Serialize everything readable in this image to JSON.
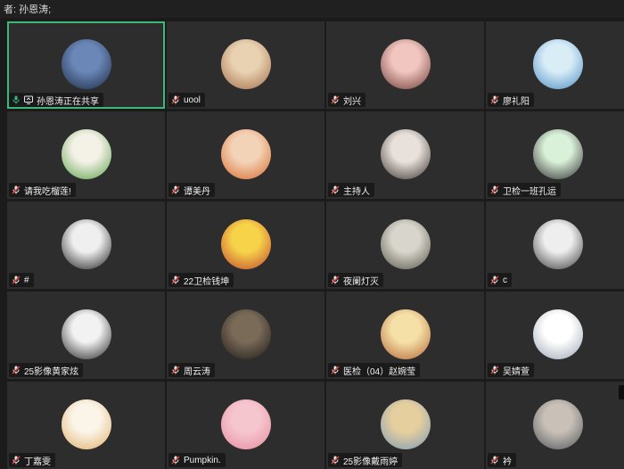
{
  "header": {
    "text": "者:  孙恩涛;"
  },
  "tiles": [
    {
      "name": "孙恩涛正在共享",
      "colors": [
        "#6b87b8",
        "#1b2a44"
      ],
      "active": true
    },
    {
      "name": "uool",
      "colors": [
        "#e9d2b2",
        "#a26c4a"
      ]
    },
    {
      "name": "刘兴",
      "colors": [
        "#f1c5c0",
        "#6b3b32"
      ]
    },
    {
      "name": "廖礼阳",
      "colors": [
        "#d9edf7",
        "#4b8ec2"
      ]
    },
    {
      "name": "请我吃榴莲!",
      "colors": [
        "#f4f1e6",
        "#5aa24a"
      ]
    },
    {
      "name": "谭美丹",
      "colors": [
        "#f3d3b8",
        "#d96a2a"
      ]
    },
    {
      "name": "主持人",
      "colors": [
        "#e8e0da",
        "#3a3330"
      ]
    },
    {
      "name": "卫检一班孔运",
      "colors": [
        "#d9f0d9",
        "#2c2c2c"
      ]
    },
    {
      "name": "#",
      "colors": [
        "#efefef",
        "#1e1e1e"
      ]
    },
    {
      "name": "22卫检钱坤",
      "colors": [
        "#f7d34a",
        "#c0462e"
      ]
    },
    {
      "name": "夜阑灯灭",
      "colors": [
        "#d8d6cc",
        "#565348"
      ]
    },
    {
      "name": "c",
      "colors": [
        "#eeeeee",
        "#3a3a3a"
      ]
    },
    {
      "name": "25影像黄家炫",
      "colors": [
        "#f2f2f2",
        "#232323"
      ]
    },
    {
      "name": "周云涛",
      "colors": [
        "#7a6a58",
        "#1d1a16"
      ]
    },
    {
      "name": "医检（04）赵婉莹",
      "colors": [
        "#f5e1a8",
        "#b56536"
      ]
    },
    {
      "name": "吴婧萱",
      "colors": [
        "#ffffff",
        "#9aa4b2"
      ]
    },
    {
      "name": "丁嘉雯",
      "colors": [
        "#fbf4e8",
        "#e0b06a"
      ]
    },
    {
      "name": "Pumpkin.",
      "colors": [
        "#f6c6cf",
        "#e58aa0"
      ]
    },
    {
      "name": "25影像戴雨婷",
      "colors": [
        "#e6cf9e",
        "#7c9ab8"
      ]
    },
    {
      "name": "衿",
      "colors": [
        "#c9c1b8",
        "#52565c"
      ]
    }
  ]
}
